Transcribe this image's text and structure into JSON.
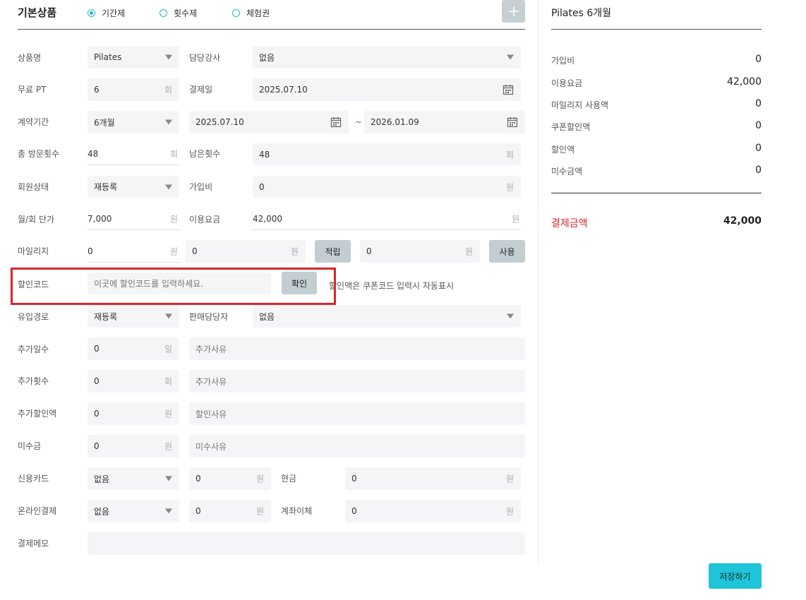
{
  "header": {
    "title": "기본상품",
    "radios": [
      {
        "label": "기간제",
        "selected": true
      },
      {
        "label": "횟수제",
        "selected": false
      },
      {
        "label": "체험권",
        "selected": false
      }
    ],
    "add_icon": "plus-icon"
  },
  "form": {
    "product_name": {
      "label": "상품명",
      "value": "Pilates"
    },
    "instructor": {
      "label": "담당강사",
      "value": "없음"
    },
    "free_pt": {
      "label": "무료 PT",
      "value": "6",
      "unit": "회"
    },
    "pay_date": {
      "label": "결제일",
      "value": "2025.07.10"
    },
    "contract": {
      "label": "계약기간",
      "value": "6개월",
      "start": "2025.07.10",
      "tilde": "~",
      "end": "2026.01.09"
    },
    "total_visits": {
      "label": "총 방문횟수",
      "value": "48",
      "unit": "회"
    },
    "remaining": {
      "label": "남은횟수",
      "value": "48",
      "unit": "회"
    },
    "member_status": {
      "label": "회원상태",
      "value": "재등록"
    },
    "join_fee": {
      "label": "가입비",
      "value": "0",
      "unit": "원"
    },
    "unit_price": {
      "label": "월/회 단가",
      "value": "7,000",
      "unit": "원"
    },
    "usage_fee": {
      "label": "이용요금",
      "value": "42,000",
      "unit": "원"
    },
    "mileage": {
      "label": "마일리지",
      "value": "0",
      "unit": "원",
      "earn_value": "0",
      "earn_button": "적립",
      "use_value": "0",
      "use_button": "사용"
    },
    "discount_code": {
      "label": "할인코드",
      "placeholder": "이곳에 할인코드를 입력하세요.",
      "button": "확인",
      "note": "할인액은 쿠폰코드 입력시 자동표시"
    },
    "inflow": {
      "label": "유입경로",
      "value": "재등록"
    },
    "sales_manager": {
      "label": "판매담당자",
      "value": "없음"
    },
    "extra_days": {
      "label": "추가일수",
      "value": "0",
      "unit": "일",
      "reason_placeholder": "추가사유"
    },
    "extra_count": {
      "label": "추가횟수",
      "value": "0",
      "unit": "회",
      "reason_placeholder": "추가사유"
    },
    "extra_discount": {
      "label": "추가할인액",
      "value": "0",
      "unit": "원",
      "reason_placeholder": "할인사유"
    },
    "unpaid": {
      "label": "미수금",
      "value": "0",
      "unit": "원",
      "reason_placeholder": "미수사유"
    },
    "credit_card": {
      "label": "신용카드",
      "value": "없음",
      "amount": "0",
      "unit": "원"
    },
    "cash": {
      "label": "현금",
      "value": "0",
      "unit": "원"
    },
    "online_pay": {
      "label": "온라인결제",
      "value": "없음",
      "amount": "0",
      "unit": "원"
    },
    "transfer": {
      "label": "계좌이체",
      "value": "0",
      "unit": "원"
    },
    "memo": {
      "label": "결제메모",
      "value": ""
    }
  },
  "summary": {
    "title": "Pilates 6개월",
    "rows": [
      {
        "label": "가입비",
        "value": "0"
      },
      {
        "label": "이용요금",
        "value": "42,000"
      },
      {
        "label": "마일리지 사용액",
        "value": "0"
      },
      {
        "label": "쿠폰할인액",
        "value": "0"
      },
      {
        "label": "할인액",
        "value": "0"
      },
      {
        "label": "미수금액",
        "value": "0"
      }
    ],
    "total_label": "결제금액",
    "total_value": "42,000",
    "save_button": "저장하기"
  },
  "colors": {
    "accent": "#1fb8cf",
    "highlight": "#d9262c",
    "total_label": "#d9262c"
  }
}
